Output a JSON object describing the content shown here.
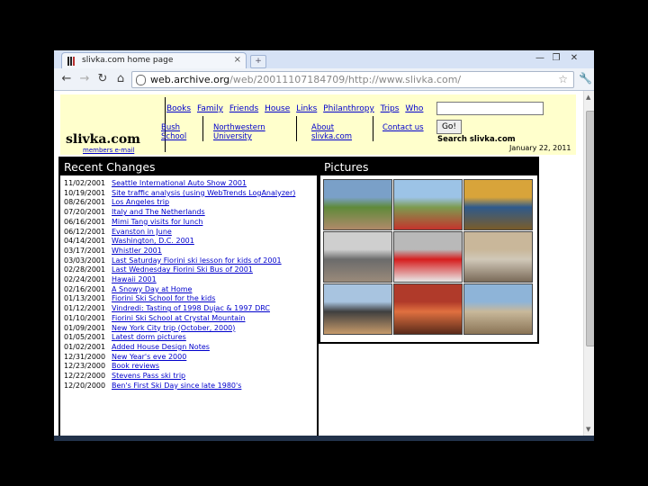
{
  "browser": {
    "tab_title": "slivka.com home page",
    "tab_close": "×",
    "new_tab": "+",
    "window_controls": [
      "—",
      "❐",
      "✕"
    ],
    "nav": {
      "back": "←",
      "forward": "→",
      "reload": "↻",
      "home": "⌂"
    },
    "url_domain": "web.archive.org",
    "url_path": "/web/20011107184709/http://www.slivka.com/",
    "star": "☆",
    "menu": "🔧"
  },
  "site": {
    "logo": "slivka.com",
    "members_link": "members e-mail",
    "top_links": [
      "Books",
      "Family",
      "Friends",
      "House",
      "Links",
      "Philanthropy",
      "Trips",
      "Who"
    ],
    "sub_links": [
      {
        "line1": "Bush",
        "line2": "School"
      },
      {
        "line1": "Northwestern",
        "line2": "University"
      },
      {
        "line1": "About",
        "line2": "slivka.com"
      },
      {
        "line1": "Contact us",
        "line2": ""
      }
    ],
    "search_button": "Go!",
    "search_label": "Search slivka.com",
    "date": "January 22, 2011",
    "recent_title": "Recent Changes",
    "pictures_title": "Pictures",
    "recent_changes": [
      {
        "date": "11/02/2001",
        "text": "Seattle International Auto Show 2001"
      },
      {
        "date": "10/19/2001",
        "text": "Site traffic analysis (using WebTrends LogAnalyzer)"
      },
      {
        "date": "08/26/2001",
        "text": "Los Angeles trip"
      },
      {
        "date": "07/20/2001",
        "text": "Italy and The Netherlands"
      },
      {
        "date": "06/16/2001",
        "text": "Mimi Tang visits for lunch"
      },
      {
        "date": "06/12/2001",
        "text": "Evanston in June"
      },
      {
        "date": "04/14/2001",
        "text": "Washington, D.C. 2001"
      },
      {
        "date": "03/17/2001",
        "text": "Whistler 2001"
      },
      {
        "date": "03/03/2001",
        "text": "Last Saturday Fiorini ski lesson for kids of 2001"
      },
      {
        "date": "02/28/2001",
        "text": "Last Wednesday Fiorini Ski Bus of 2001"
      },
      {
        "date": "02/24/2001",
        "text": "Hawaii 2001"
      },
      {
        "date": "02/16/2001",
        "text": "A Snowy Day at Home"
      },
      {
        "date": "01/13/2001",
        "text": "Fiorini Ski School for the kids"
      },
      {
        "date": "01/12/2001",
        "text": "Vindredi: Tasting of 1998 Dujac & 1997 DRC"
      },
      {
        "date": "01/10/2001",
        "text": "Fiorini Ski School at Crystal Mountain"
      },
      {
        "date": "01/09/2001",
        "text": "New York City trip (October, 2000)"
      },
      {
        "date": "01/05/2001",
        "text": "Latest dorm pictures"
      },
      {
        "date": "01/02/2001",
        "text": "Added House Design Notes"
      },
      {
        "date": "12/31/2000",
        "text": "New Year's eve 2000"
      },
      {
        "date": "12/23/2000",
        "text": "Book reviews"
      },
      {
        "date": "12/22/2000",
        "text": "Stevens Pass ski trip"
      },
      {
        "date": "12/20/2000",
        "text": "Ben's First Ski Day since late 1980's"
      }
    ],
    "pictures": [
      {
        "name": "garden-photo",
        "colors": [
          "#7aa0c8",
          "#5f8a3a",
          "#b08a6a"
        ]
      },
      {
        "name": "cyclists-photo",
        "colors": [
          "#9cc3e6",
          "#7d9b4f",
          "#c4342d"
        ]
      },
      {
        "name": "painting-photo",
        "colors": [
          "#d8a43a",
          "#2e5a8c",
          "#7a5c2a"
        ]
      },
      {
        "name": "wine-cellar-photo",
        "colors": [
          "#cfcfcf",
          "#6b6b6b",
          "#9a8a7a"
        ]
      },
      {
        "name": "race-car-photo",
        "colors": [
          "#b9b9b9",
          "#d61e1e",
          "#e8e8e8"
        ]
      },
      {
        "name": "building-sign-photo",
        "colors": [
          "#c9b79a",
          "#d0c8b8",
          "#7a6a58"
        ]
      },
      {
        "name": "couple-photo",
        "colors": [
          "#a8c4e0",
          "#3f3f3f",
          "#c69a6a"
        ]
      },
      {
        "name": "seafood-photo",
        "colors": [
          "#b03a2a",
          "#e07040",
          "#5a2a1a"
        ]
      },
      {
        "name": "colosseum-photo",
        "colors": [
          "#8eb4d8",
          "#c8b89a",
          "#8a7456"
        ]
      }
    ]
  }
}
